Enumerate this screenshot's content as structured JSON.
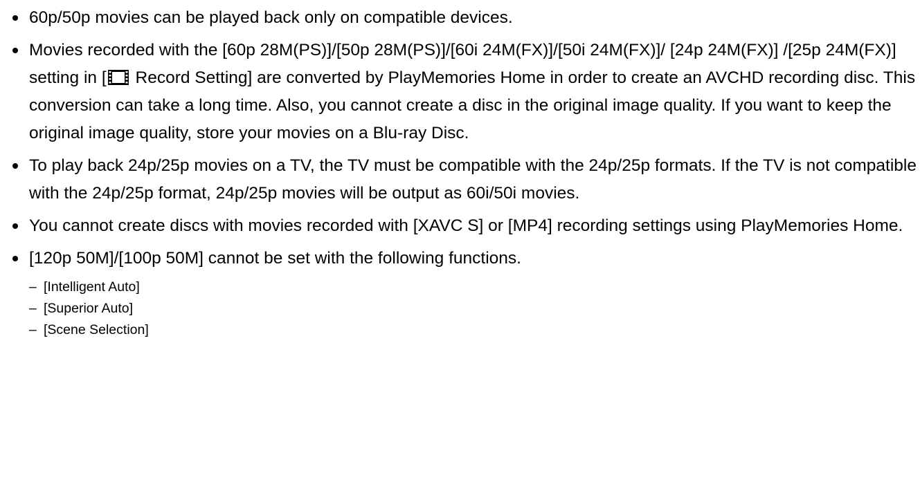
{
  "bullets": [
    {
      "text": "60p/50p movies can be played back only on compatible devices."
    },
    {
      "text_before_icon": "Movies recorded with the [60p 28M(PS)]/[50p 28M(PS)]/[60i 24M(FX)]/[50i 24M(FX)]/ [24p 24M(FX)] /[25p 24M(FX)] setting in [",
      "icon": "movie-film-icon",
      "text_after_icon": " Record Setting] are converted by PlayMemories Home in order to create an AVCHD recording disc. This conversion can take a long time. Also, you cannot create a disc in the original image quality. If you want to keep the original image quality, store your movies on a Blu-ray Disc."
    },
    {
      "text": "To play back 24p/25p movies on a TV, the TV must be compatible with the 24p/25p formats. If the TV is not compatible with the 24p/25p format, 24p/25p movies will be output as 60i/50i movies."
    },
    {
      "text": "You cannot create discs with movies recorded with [XAVC S] or [MP4] recording settings using PlayMemories Home."
    },
    {
      "text": "[120p 50M]/[100p 50M] cannot be set with the following functions.",
      "sub_items": [
        "[Intelligent Auto]",
        "[Superior Auto]",
        "[Scene Selection]"
      ]
    }
  ],
  "sub_item_marker": "–"
}
